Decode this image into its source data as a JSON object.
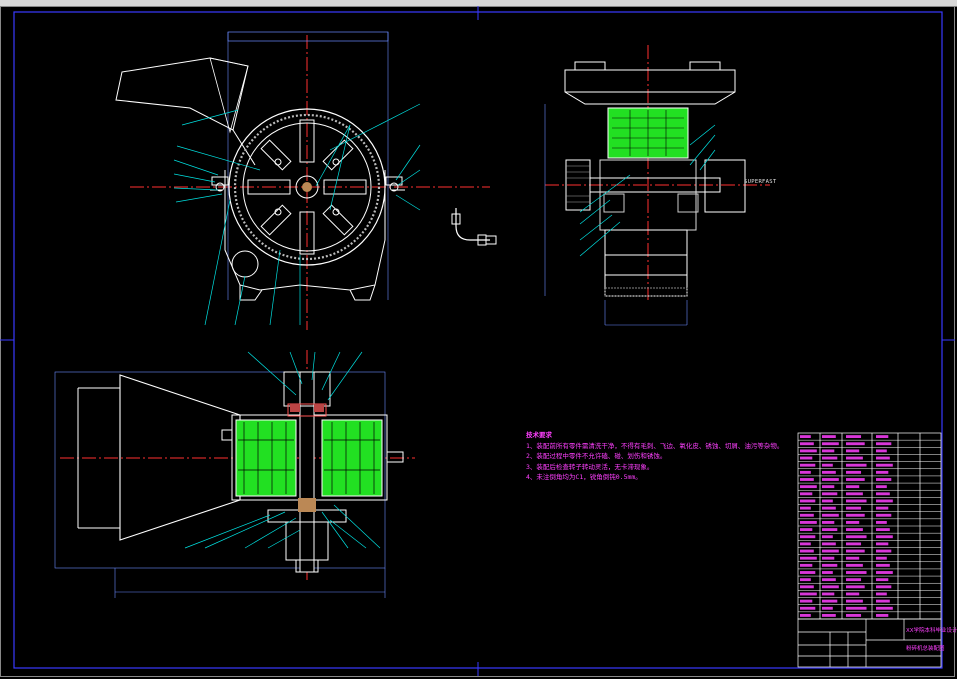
{
  "drawing": {
    "kind": "mechanical-assembly-drawing",
    "background_color": "#000000",
    "frame_color": "#3a3aff",
    "outline_color": "#ffffff",
    "centerline_color": "#ff3030",
    "leader_color": "#00e0e0",
    "fill_color": "#22e022",
    "notes_color": "#ff40ff",
    "dimension_color": "#6a8aff"
  },
  "labels": {
    "shaft_text": "SUPERFAST"
  },
  "tech_notes": {
    "heading": "技术要求",
    "lines": [
      "1、装配前所有零件需清洗干净，不得有毛刺、飞边、氧化皮、锈蚀、切屑、油污等杂物。",
      "2、装配过程中零件不允许磕、碰、划伤和锈蚀。",
      "3、装配后检查转子转动灵活，无卡滞现象。",
      "4、未注倒角均为C1，锐角倒钝0.5mm。"
    ]
  },
  "title_block": {
    "company": "XX学院本科毕业设计",
    "drawing_title": "粉碎机总装配图"
  }
}
